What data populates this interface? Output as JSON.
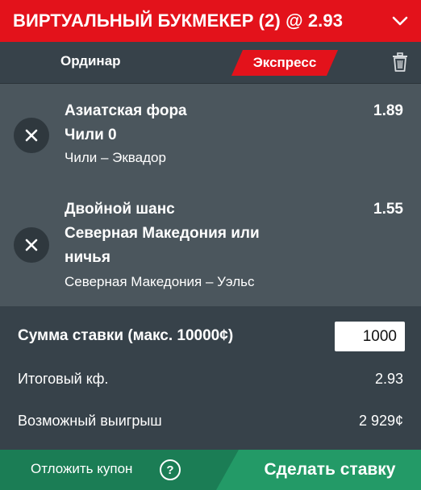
{
  "header": {
    "title": "ВИРТУАЛЬНЫЙ БУКМЕКЕР (2) @ 2.93",
    "collapse_icon": "chevron-down-icon"
  },
  "tabs": {
    "single": "Ординар",
    "express": "Экспресс",
    "active": "express",
    "clear_icon": "trash-icon"
  },
  "bets": [
    {
      "market": "Азиатская фора",
      "selection": "Чили 0",
      "selection_cont": "",
      "event": "Чили – Эквадор",
      "odds": "1.89"
    },
    {
      "market": "Двойной шанс",
      "selection": "Северная Македония или",
      "selection_cont": "ничья",
      "event": "Северная Македония – Уэльс",
      "odds": "1.55"
    }
  ],
  "summary": {
    "stake_label": "Сумма ставки (макс. 10000¢)",
    "stake_value": "1000",
    "total_odds_label": "Итоговый кф.",
    "total_odds_value": "2.93",
    "possible_win_label": "Возможный выигрыш",
    "possible_win_value": "2 929¢"
  },
  "footer": {
    "postpone_label": "Отложить купон",
    "help_label": "?",
    "place_bet_label": "Сделать ставку"
  },
  "colors": {
    "brand_red": "#e3121b",
    "dark_bg": "#37424a",
    "bet_bg": "#4b565d",
    "footer_green": "#1b7d55",
    "button_green": "#239a67"
  }
}
